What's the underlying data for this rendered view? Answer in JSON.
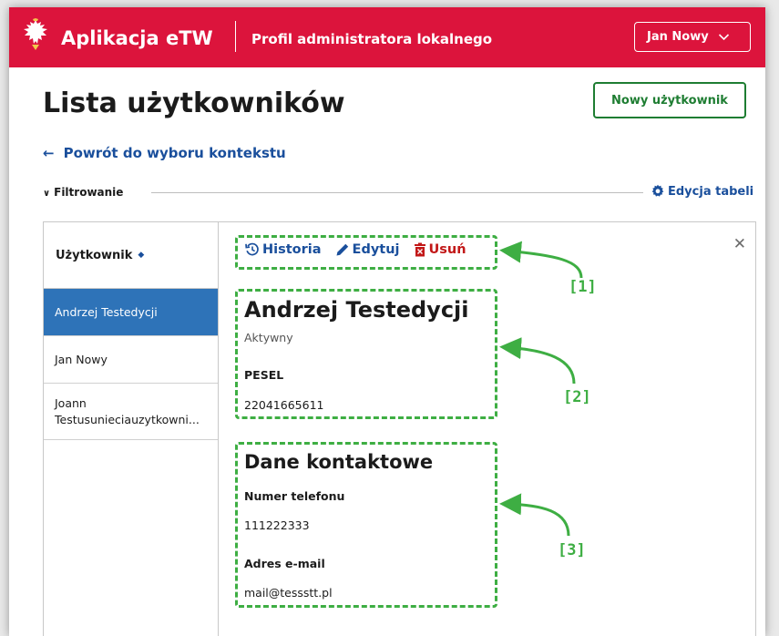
{
  "header": {
    "app_name": "Aplikacja eTW",
    "profile": "Profil administratora lokalnego",
    "user_menu": "Jan Nowy"
  },
  "page": {
    "title": "Lista użytkowników",
    "new_user_button": "Nowy użytkownik",
    "back_link": "Powrót do wyboru kontekstu",
    "filter_label": "Filtrowanie",
    "edit_table": "Edycja tabeli"
  },
  "list": {
    "column_header": "Użytkownik",
    "rows": [
      {
        "name": "Andrzej Testedycji",
        "active": true
      },
      {
        "name": "Jan Nowy",
        "active": false
      },
      {
        "name_line1": "Joann",
        "name_line2": "Testusunieciauzytkowni...",
        "active": false
      }
    ]
  },
  "detail": {
    "actions": {
      "history": "Historia",
      "edit": "Edytuj",
      "delete": "Usuń"
    },
    "name": "Andrzej Testedycji",
    "status": "Aktywny",
    "pesel_label": "PESEL",
    "pesel_value": "22041665611",
    "contact_title": "Dane kontaktowe",
    "phone_label": "Numer telefonu",
    "phone_value": "111222333",
    "email_label": "Adres e-mail",
    "email_value": "mail@tessstt.pl"
  },
  "annotations": [
    "[1]",
    "[2]",
    "[3]"
  ],
  "colors": {
    "header_red": "#dc143c",
    "link_blue": "#1a4f9c",
    "active_row": "#2e73b8",
    "green_button": "#1e7d32",
    "annotation_green": "#3eae43",
    "delete_red": "#c21818"
  },
  "icons": [
    "eagle-emblem-icon",
    "chevron-down-icon",
    "arrow-left-icon",
    "chevron-down-small-icon",
    "gear-icon",
    "sort-icon",
    "history-icon",
    "pencil-icon",
    "trash-icon",
    "close-icon"
  ]
}
